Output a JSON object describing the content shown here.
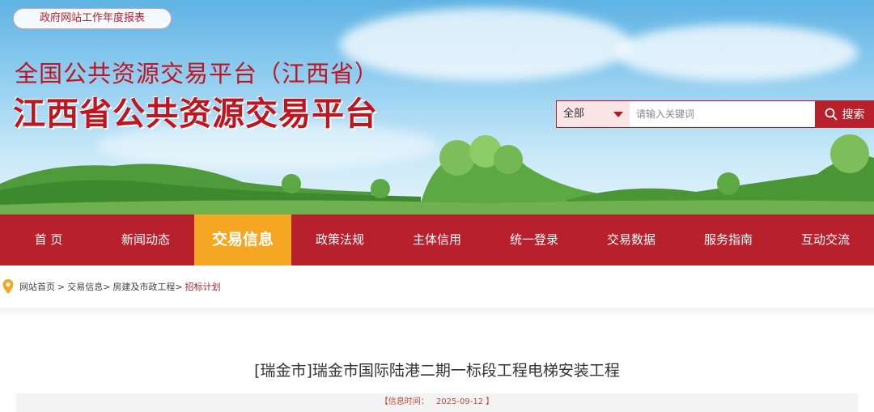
{
  "banner": {
    "report_link": "政府网站工作年度报表",
    "sub_title": "全国公共资源交易平台（江西省）",
    "main_title": "江西省公共资源交易平台"
  },
  "search": {
    "scope_selected": "全部",
    "placeholder": "请输入关键词",
    "button_label": "搜索"
  },
  "nav": {
    "items": [
      {
        "label": "首 页"
      },
      {
        "label": "新闻动态"
      },
      {
        "label": "交易信息"
      },
      {
        "label": "政策法规"
      },
      {
        "label": "主体信用"
      },
      {
        "label": "统一登录"
      },
      {
        "label": "交易数据"
      },
      {
        "label": "服务指南"
      },
      {
        "label": "互动交流"
      }
    ],
    "active_index": 2
  },
  "breadcrumb": {
    "home": "网站首页",
    "level1": "交易信息",
    "level2": "房建及市政工程",
    "sep": ">",
    "current": "招标计划"
  },
  "article": {
    "title": "[瑞金市]瑞金市国际陆港二期一标段工程电梯安装工程",
    "info_label": "【信息时间：",
    "info_date": "2025-09-12",
    "info_close": "】"
  },
  "colors": {
    "brand_red": "#b8202b",
    "active_orange": "#f5a623",
    "title_red": "#c0141f"
  }
}
